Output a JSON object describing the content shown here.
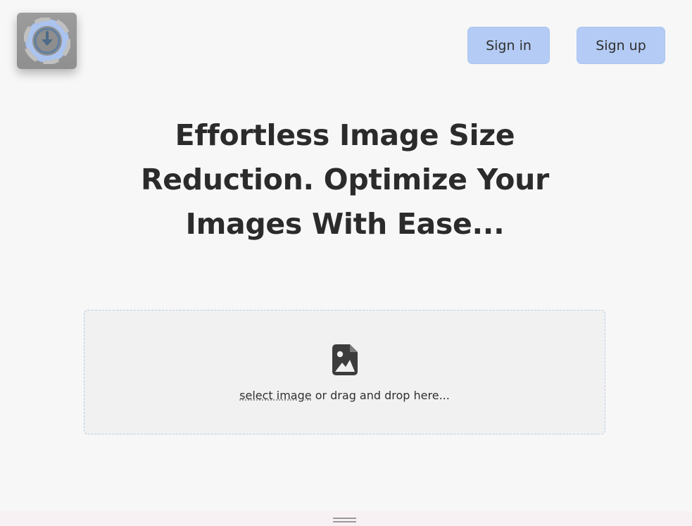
{
  "header": {
    "logo_icon": "download-circle-icon",
    "signin_label": "Sign in",
    "signup_label": "Sign up",
    "button_color": "#b4ccf5"
  },
  "hero": {
    "heading": "Effortless Image Size Reduction. Optimize Your Images With Ease..."
  },
  "upload": {
    "icon": "image-file-icon",
    "select_label": "select image",
    "drop_label": " or drag and drop here..."
  },
  "footer": {
    "handle_icon": "drag-handle-icon"
  }
}
